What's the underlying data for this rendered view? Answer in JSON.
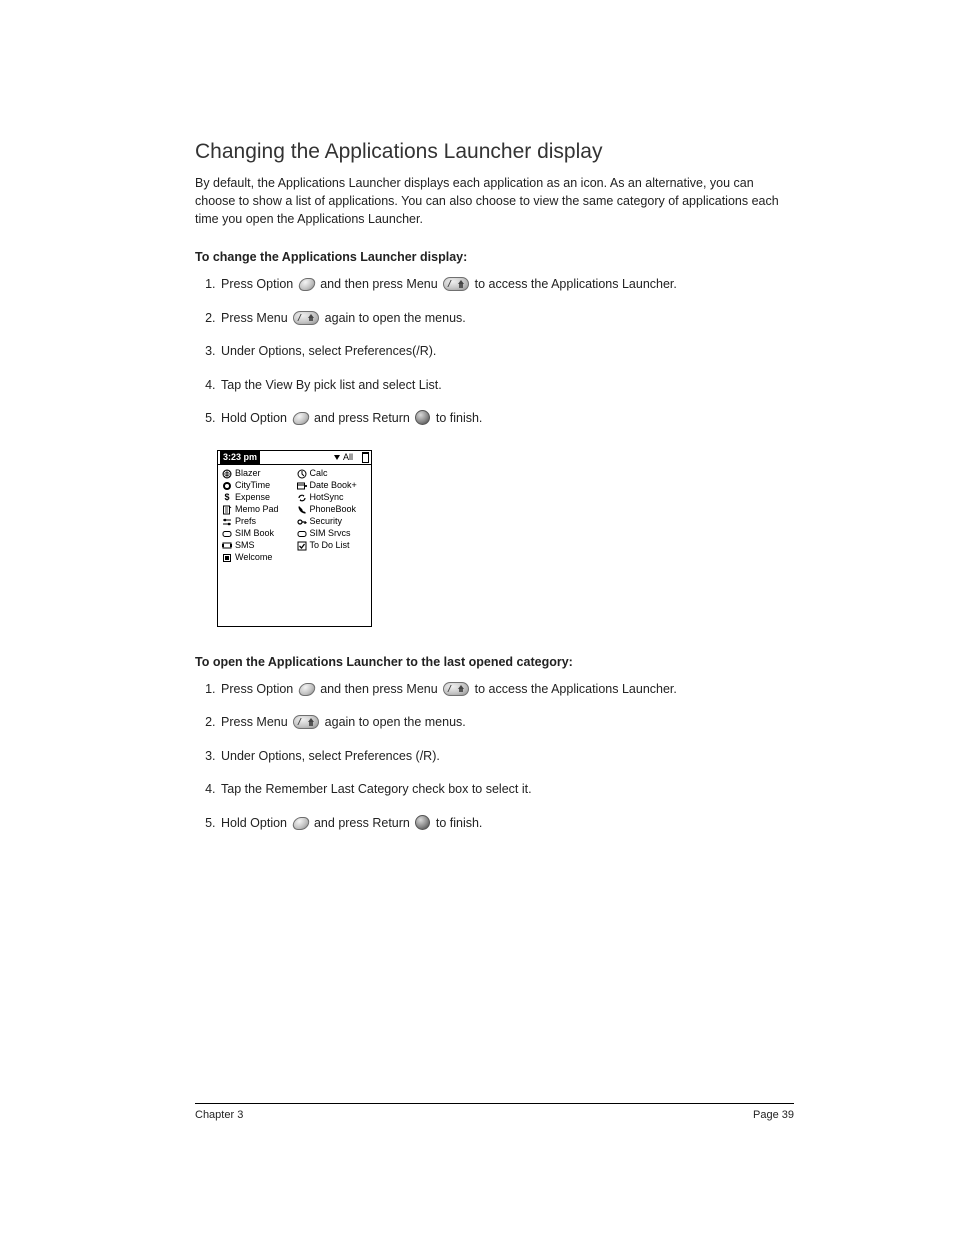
{
  "title": "Changing the Applications Launcher display",
  "intro": "By default, the Applications Launcher displays each application as an icon. As an alternative, you can choose to show a list of applications. You can also choose to view the same category of applications each time you open the Applications Launcher.",
  "section1": {
    "heading": "To change the Applications Launcher display:",
    "steps": {
      "s1a": "Press Option",
      "s1b": "and then press Menu",
      "s1c": "to access the Applications Launcher.",
      "s2a": "Press Menu",
      "s2b": "again to open the menus.",
      "s3": "Under Options, select Preferences(/R).",
      "s4": "Tap the View By pick list and select List.",
      "s5a": "Hold Option",
      "s5b": "and press Return",
      "s5c": "to finish."
    }
  },
  "palm": {
    "time": "3:23 pm",
    "category": "All",
    "apps_left": [
      "Blazer",
      "CityTime",
      "Expense",
      "Memo Pad",
      "Prefs",
      "SIM Book",
      "SMS",
      "Welcome"
    ],
    "apps_right": [
      "Calc",
      "Date Book+",
      "HotSync",
      "PhoneBook",
      "Security",
      "SIM Srvcs",
      "To Do List"
    ]
  },
  "section2": {
    "heading": "To open the Applications Launcher to the last opened category:",
    "steps": {
      "s1a": "Press Option",
      "s1b": "and then press Menu",
      "s1c": "to access the Applications Launcher.",
      "s2a": "Press Menu",
      "s2b": "again to open the menus.",
      "s3": "Under Options, select Preferences (/R).",
      "s4": "Tap the Remember Last Category check box to select it.",
      "s5a": "Hold Option",
      "s5b": "and press Return",
      "s5c": "to finish."
    }
  },
  "footer": {
    "left": "Chapter 3",
    "right": "Page 39"
  }
}
